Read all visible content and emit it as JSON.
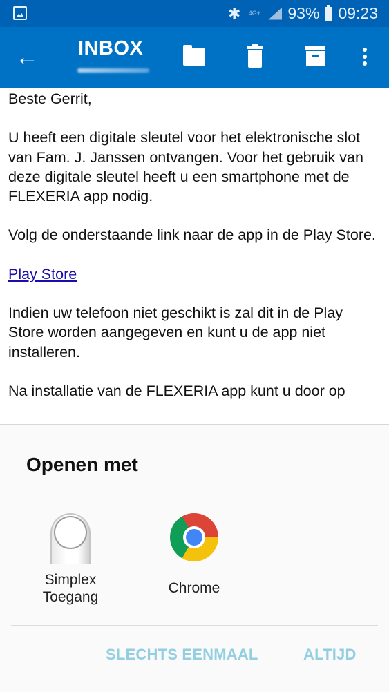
{
  "status_bar": {
    "network_label": "4G+",
    "battery": "93%",
    "time": "09:23"
  },
  "app_bar": {
    "title": "INBOX",
    "icons": [
      "back-arrow-icon",
      "folder-icon",
      "trash-icon",
      "archive-icon",
      "more-vert-icon"
    ]
  },
  "email": {
    "greeting": "Beste Gerrit,",
    "paragraph1": "U heeft een digitale sleutel voor het elektronische slot van Fam. J. Janssen ontvangen. Voor het gebruik van deze digitale sleutel heeft u een smartphone met de FLEXERIA app nodig.",
    "paragraph2": "Volg de onderstaande link naar de app in de Play Store.",
    "link": "Play Store",
    "paragraph3": "Indien uw telefoon niet geschikt is zal dit in de Play Store worden aangegeven en kunt u de app niet installeren.",
    "paragraph4": "Na installatie van de FLEXERIA app kunt u door op"
  },
  "chooser": {
    "title": "Openen met",
    "apps": [
      {
        "label": "Simplex Toegang",
        "icon": "simplex-app-icon"
      },
      {
        "label": "Chrome",
        "icon": "chrome-icon"
      }
    ],
    "button_once": "SLECHTS EENMAAL",
    "button_always": "ALTIJD",
    "button_color": "#93cfe0"
  }
}
